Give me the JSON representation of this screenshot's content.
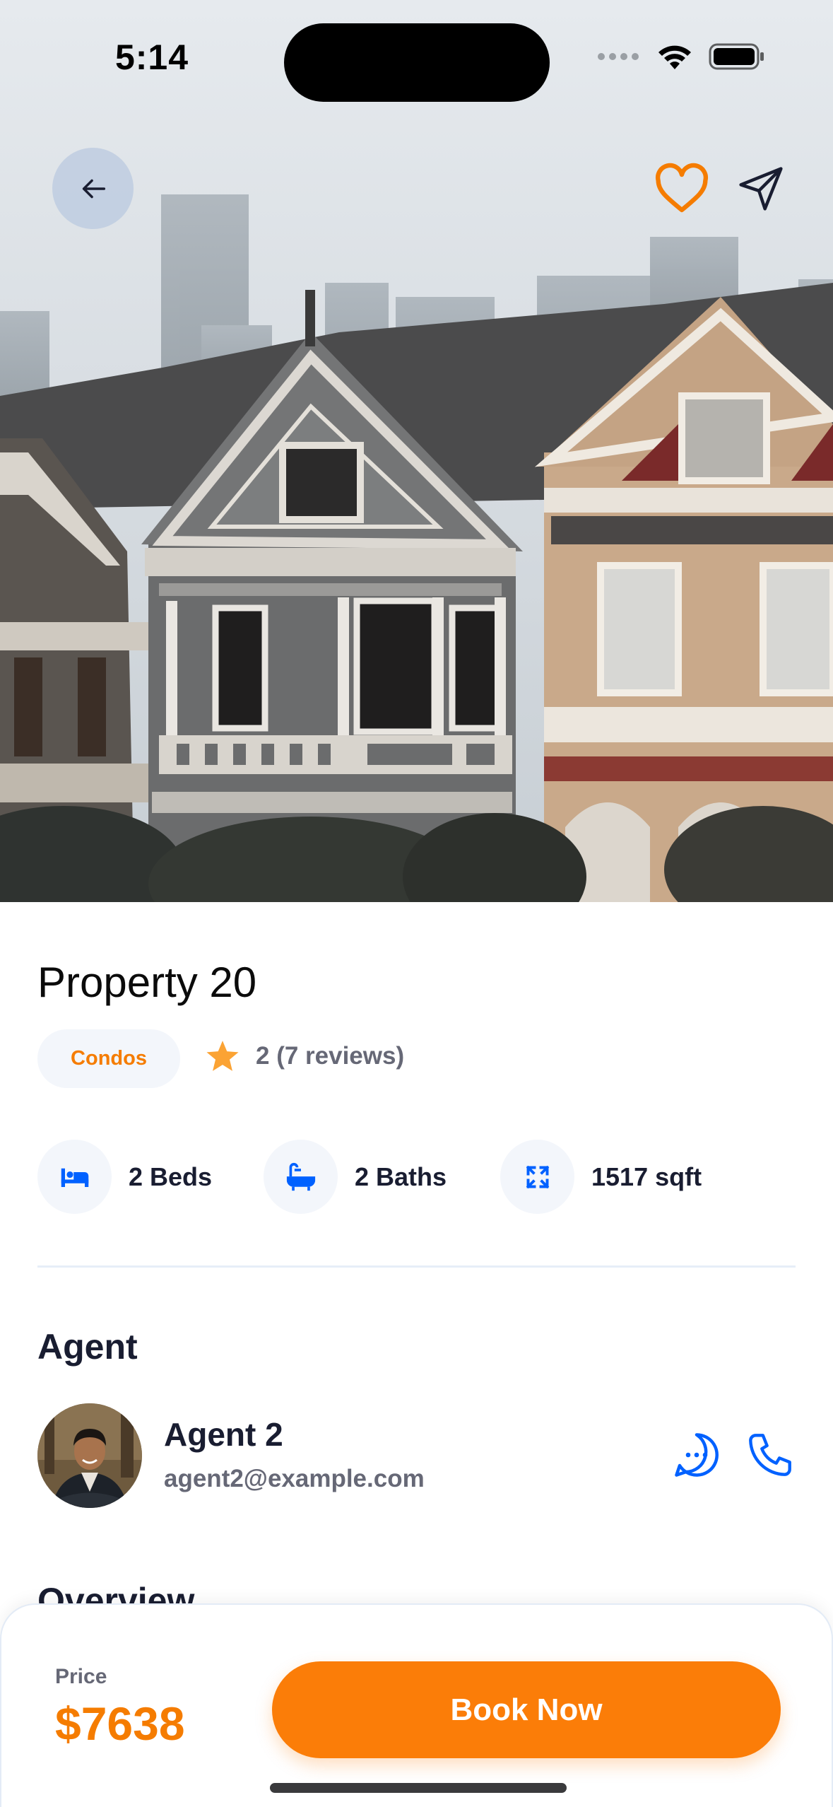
{
  "status_bar": {
    "time": "5:14"
  },
  "icons": {
    "back": "arrow-left-icon",
    "favorite": "heart-icon",
    "share": "send-icon",
    "star": "star-icon",
    "bed": "bed-icon",
    "bath": "bath-icon",
    "area": "expand-icon",
    "chat": "chat-icon",
    "call": "phone-icon"
  },
  "property": {
    "title": "Property 20",
    "category": "Condos",
    "rating_text": "2 (7 reviews)",
    "features": [
      {
        "label": "2 Beds",
        "icon": "bed-icon"
      },
      {
        "label": "2 Baths",
        "icon": "bath-icon"
      },
      {
        "label": "1517 sqft",
        "icon": "expand-icon"
      }
    ]
  },
  "agent_section": {
    "heading": "Agent",
    "name": "Agent 2",
    "email": "agent2@example.com"
  },
  "overview_section": {
    "heading": "Overview"
  },
  "bottom_bar": {
    "price_label": "Price",
    "price_value": "$7638",
    "book_label": "Book Now"
  },
  "colors": {
    "accent": "#FB7D08",
    "price": "#F57C00",
    "text_primary": "#191D31",
    "text_secondary": "#666876",
    "icon_blue": "#0061FF",
    "chip_bg": "#F3F6FB"
  }
}
